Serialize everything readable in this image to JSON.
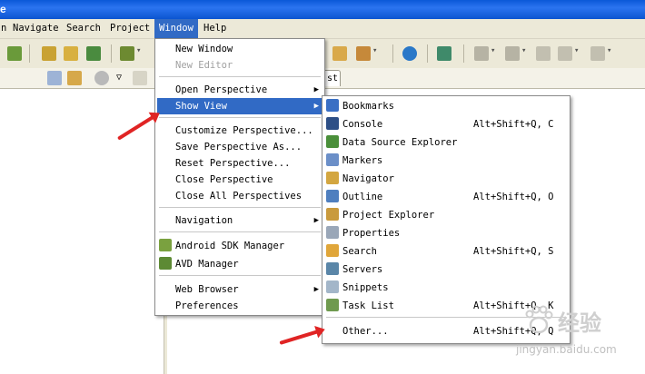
{
  "titlebar": {
    "text": "e"
  },
  "menubar": {
    "items": [
      "n",
      "Navigate",
      "Search",
      "Project",
      "Window",
      "Help"
    ],
    "active": "Window"
  },
  "view_tab": {
    "text": "st"
  },
  "window_menu": {
    "items": [
      {
        "label": "New Window",
        "enabled": true
      },
      {
        "label": "New Editor",
        "enabled": false
      },
      {
        "label": "Open Perspective",
        "submenu": true
      },
      {
        "label": "Show View",
        "submenu": true,
        "highlighted": true
      },
      {
        "label": "Customize Perspective..."
      },
      {
        "label": "Save Perspective As..."
      },
      {
        "label": "Reset Perspective..."
      },
      {
        "label": "Close Perspective"
      },
      {
        "label": "Close All Perspectives"
      },
      {
        "label": "Navigation",
        "submenu": true
      },
      {
        "label": "Android SDK Manager",
        "icon": "android-sdk-icon"
      },
      {
        "label": "AVD Manager",
        "icon": "avd-device-icon"
      },
      {
        "label": "Web Browser",
        "submenu": true
      },
      {
        "label": "Preferences"
      }
    ]
  },
  "show_view_menu": {
    "items": [
      {
        "label": "Bookmarks",
        "shortcut": "",
        "icon": "bookmarks-icon"
      },
      {
        "label": "Console",
        "shortcut": "Alt+Shift+Q, C",
        "icon": "console-icon"
      },
      {
        "label": "Data Source Explorer",
        "shortcut": "",
        "icon": "data-source-explorer-icon"
      },
      {
        "label": "Markers",
        "shortcut": "",
        "icon": "markers-icon"
      },
      {
        "label": "Navigator",
        "shortcut": "",
        "icon": "navigator-icon"
      },
      {
        "label": "Outline",
        "shortcut": "Alt+Shift+Q, O",
        "icon": "outline-icon"
      },
      {
        "label": "Project Explorer",
        "shortcut": "",
        "icon": "project-explorer-icon"
      },
      {
        "label": "Properties",
        "shortcut": "",
        "icon": "properties-icon"
      },
      {
        "label": "Search",
        "shortcut": "Alt+Shift+Q, S",
        "icon": "search-icon"
      },
      {
        "label": "Servers",
        "shortcut": "",
        "icon": "servers-icon"
      },
      {
        "label": "Snippets",
        "shortcut": "",
        "icon": "snippets-icon"
      },
      {
        "label": "Task List",
        "shortcut": "Alt+Shift+Q, K",
        "icon": "task-list-icon"
      },
      {
        "label": "Other...",
        "shortcut": "Alt+Shift+Q, Q"
      }
    ]
  },
  "watermark": {
    "logo_text": "经验",
    "url_text": "jingyan.baidu.com"
  },
  "colors": {
    "highlight": "#316ac5",
    "annotation": "#e02424",
    "chrome": "#ece9d8"
  }
}
